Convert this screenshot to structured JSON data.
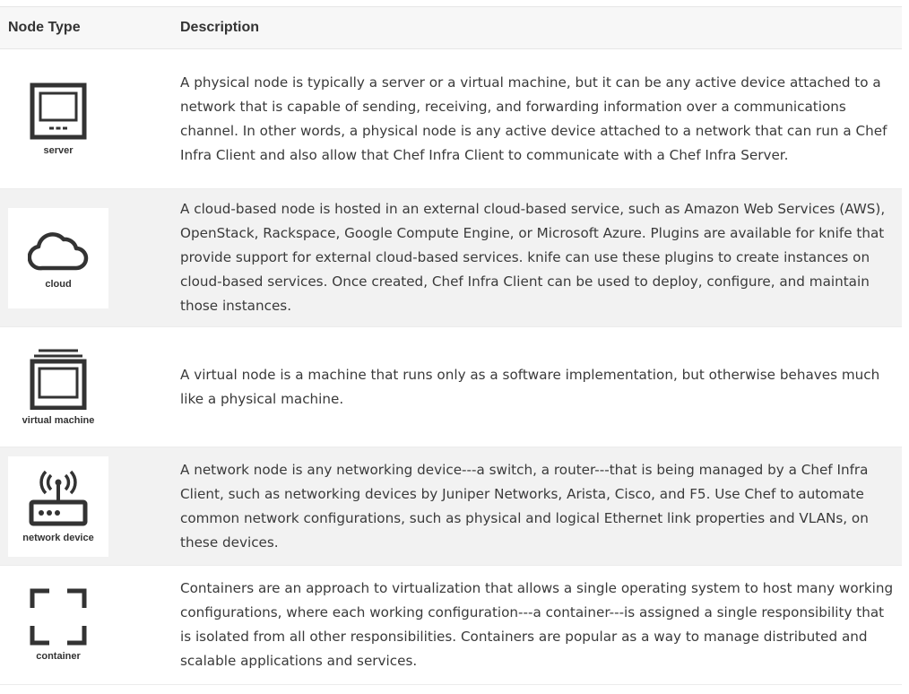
{
  "table": {
    "headers": {
      "node_type": "Node Type",
      "description": "Description"
    },
    "rows": [
      {
        "icon": "server-icon",
        "label": "server",
        "description": "A physical node is typically a server or a virtual machine, but it can be any active device attached to a network that is capable of sending, receiving, and forwarding information over a communications channel. In other words, a physical node is any active device attached to a network that can run a Chef Infra Client and also allow that Chef Infra Client to communicate with a Chef Infra Server."
      },
      {
        "icon": "cloud-icon",
        "label": "cloud",
        "description": "A cloud-based node is hosted in an external cloud-based service, such as Amazon Web Services (AWS), OpenStack, Rackspace, Google Compute Engine, or Microsoft Azure. Plugins are available for knife that provide support for external cloud-based services. knife can use these plugins to create instances on cloud-based services. Once created, Chef Infra Client can be used to deploy, configure, and maintain those instances."
      },
      {
        "icon": "virtual-machine-icon",
        "label": "virtual machine",
        "description": "A virtual node is a machine that runs only as a software implementation, but otherwise behaves much like a physical machine."
      },
      {
        "icon": "network-device-icon",
        "label": "network device",
        "description": "A network node is any networking device---a switch, a router---that is being managed by a Chef Infra Client, such as networking devices by Juniper Networks, Arista, Cisco, and F5. Use Chef to automate common network configurations, such as physical and logical Ethernet link properties and VLANs, on these devices."
      },
      {
        "icon": "container-icon",
        "label": "container",
        "description": "Containers are an approach to virtualization that allows a single operating system to host many working configurations, where each working configuration---a container---is assigned a single responsibility that is isolated from all other responsibilities. Containers are popular as a way to manage distributed and scalable applications and services."
      }
    ]
  }
}
